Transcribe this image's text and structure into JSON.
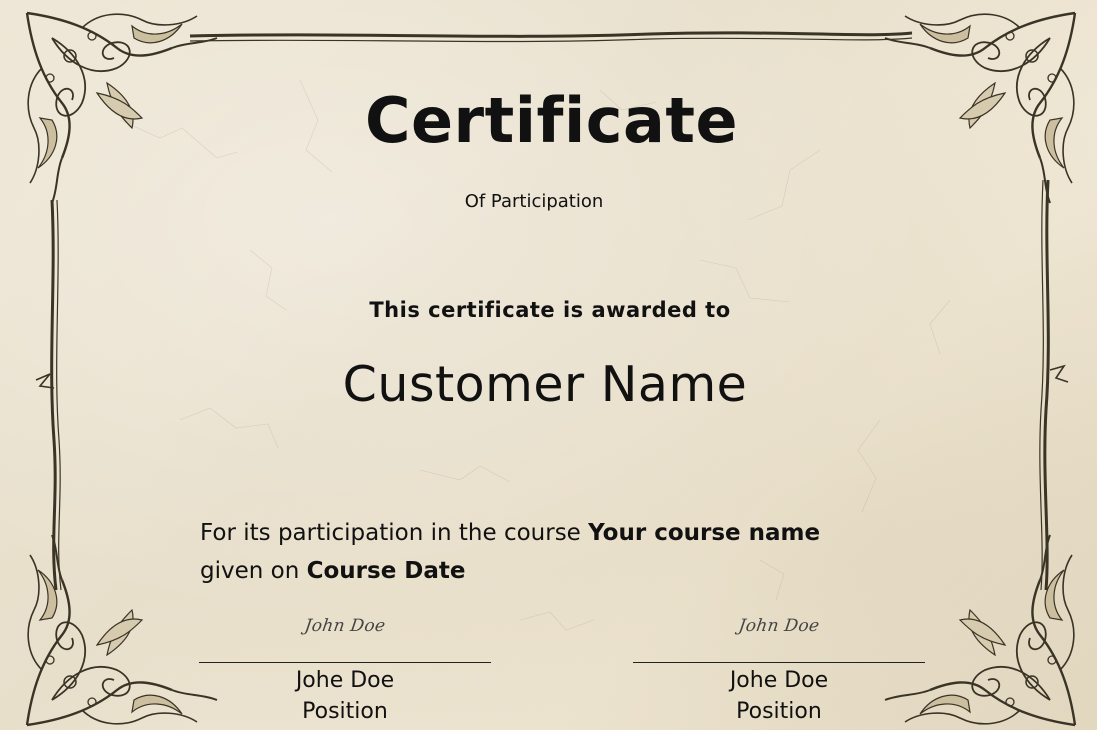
{
  "certificate": {
    "title": "Certificate",
    "subtitle": "Of Participation",
    "awarded_text": "This certificate is awarded to",
    "recipient_name": "Customer Name",
    "body": {
      "participation_prefix": "For its participation in the course",
      "course_name": "Your course name",
      "given_prefix": "given on",
      "course_date": "Course Date"
    }
  },
  "signatures": [
    {
      "signature": "John Doe",
      "name": "Johe Doe",
      "position": "Position"
    },
    {
      "signature": "John Doe",
      "name": "Johe Doe",
      "position": "Position"
    }
  ],
  "colors": {
    "paper": "#ece4d2",
    "border": "#3a3426",
    "text": "#111111"
  },
  "icons": {
    "corner_ornament": "floral-corner-ornament-icon"
  }
}
